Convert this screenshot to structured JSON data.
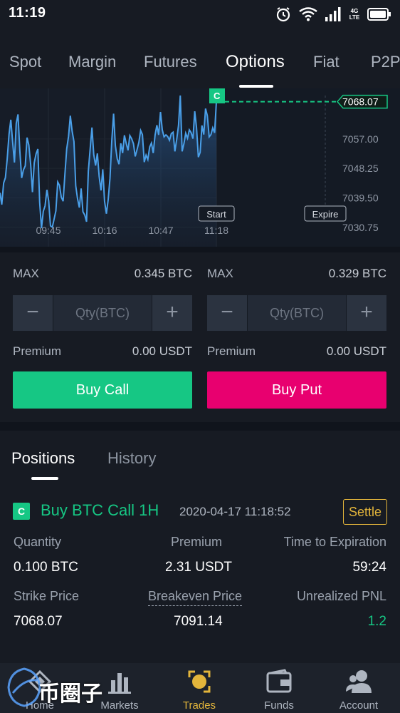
{
  "status_bar": {
    "time": "11:19",
    "network": "4G LTE",
    "icons": [
      "alarm-icon",
      "wifi-icon",
      "signal-icon",
      "battery-icon"
    ]
  },
  "tabs": [
    {
      "label": "Spot",
      "active": false
    },
    {
      "label": "Margin",
      "active": false
    },
    {
      "label": "Futures",
      "active": false
    },
    {
      "label": "Options",
      "active": true
    },
    {
      "label": "Fiat",
      "active": false
    },
    {
      "label": "P2P",
      "active": false
    }
  ],
  "chart_data": {
    "type": "line",
    "x": [
      "09:45",
      "10:16",
      "10:47",
      "11:18"
    ],
    "y_ticks": [
      "7057.00",
      "7048.25",
      "7039.50",
      "7030.75"
    ],
    "current_price": "7068.07",
    "current_marker": "C",
    "markers": {
      "start": "Start",
      "expire": "Expire"
    },
    "ylim": [
      7025,
      7072
    ],
    "series": [
      {
        "values": [
          7041.0,
          7037.5,
          7043.9,
          7045.5,
          7051.0,
          7058.4,
          7062.7,
          7056.2,
          7050.0,
          7061.6,
          7064.3,
          7053.4,
          7045.4,
          7047.8,
          7049.0,
          7057.4,
          7055.2,
          7049.4,
          7041.2,
          7049.9,
          7052.6,
          7054.0,
          7038.3,
          7030.5,
          7035.5,
          7037.1,
          7041.9,
          7038.6,
          7031.2,
          7030.8,
          7033.2,
          7035.6,
          7044.2,
          7043.2,
          7039.7,
          7038.5,
          7046.5,
          7054.0,
          7057.8,
          7063.9,
          7059.4,
          7056.2,
          7043.1,
          7039.3,
          7036.6,
          7042.3,
          7035.4,
          7034.4,
          7032.4,
          7047.4,
          7054.1,
          7060.4,
          7052.4,
          7049.1,
          7052.7,
          7045.9,
          7041.7,
          7048.0,
          7038.5,
          7034.8,
          7039.0,
          7045.2,
          7056.6,
          7064.5,
          7055.0,
          7051.1,
          7049.5,
          7055.7,
          7052.8,
          7058.1,
          7055.7,
          7053.6,
          7058.0,
          7057.1,
          7055.6,
          7051.8,
          7053.8,
          7056.0,
          7059.5,
          7058.3,
          7050.1,
          7052.2,
          7050.9,
          7054.6,
          7055.8,
          7052.8,
          7058.2,
          7061.1,
          7058.2,
          7065.0,
          7059.7,
          7057.6,
          7058.2,
          7057.7,
          7056.6,
          7058.6,
          7059.0,
          7053.3,
          7056.9,
          7061.0,
          7069.9,
          7053.3,
          7055.6,
          7058.7,
          7057.2,
          7059.7,
          7058.9,
          7057.1,
          7065.2,
          7060.4,
          7051.6,
          7053.0,
          7061.0,
          7058.3,
          7066.0,
          7063.9,
          7057.6,
          7058.3,
          7060.3,
          7058.8,
          7068.0
        ]
      }
    ]
  },
  "trade": {
    "call": {
      "max_label": "MAX",
      "max_value": "0.345 BTC",
      "qty_placeholder": "Qty(BTC)",
      "premium_label": "Premium",
      "premium_value": "0.00 USDT",
      "button": "Buy Call",
      "button_color": "#16c784"
    },
    "put": {
      "max_label": "MAX",
      "max_value": "0.329 BTC",
      "qty_placeholder": "Qty(BTC)",
      "premium_label": "Premium",
      "premium_value": "0.00 USDT",
      "button": "Buy Put",
      "button_color": "#e8006f"
    },
    "minus": "−",
    "plus": "+"
  },
  "positions": {
    "tabs": [
      {
        "label": "Positions",
        "active": true
      },
      {
        "label": "History",
        "active": false
      }
    ],
    "item": {
      "badge": "C",
      "title": "Buy BTC Call 1H",
      "timestamp": "2020-04-17 11:18:52",
      "settle_label": "Settle",
      "quantity_label": "Quantity",
      "quantity": "0.100 BTC",
      "premium_label": "Premium",
      "premium": "2.31 USDT",
      "expiration_label": "Time to Expiration",
      "expiration": "59:24",
      "strike_label": "Strike Price",
      "strike": "7068.07",
      "breakeven_label": "Breakeven Price",
      "breakeven": "7091.14",
      "pnl_label": "Unrealized PNL",
      "pnl": "1.2"
    }
  },
  "nav": [
    {
      "label": "Home",
      "icon": "home-icon",
      "active": false
    },
    {
      "label": "Markets",
      "icon": "markets-icon",
      "active": false
    },
    {
      "label": "Trades",
      "icon": "trades-icon",
      "active": true
    },
    {
      "label": "Funds",
      "icon": "wallet-icon",
      "active": false
    },
    {
      "label": "Account",
      "icon": "account-icon",
      "active": false
    }
  ],
  "watermark": {
    "text": "币圈子"
  },
  "colors": {
    "up": "#16c784",
    "down": "#e8006f",
    "accent": "#e3b53b",
    "line": "#4a9fe8"
  }
}
